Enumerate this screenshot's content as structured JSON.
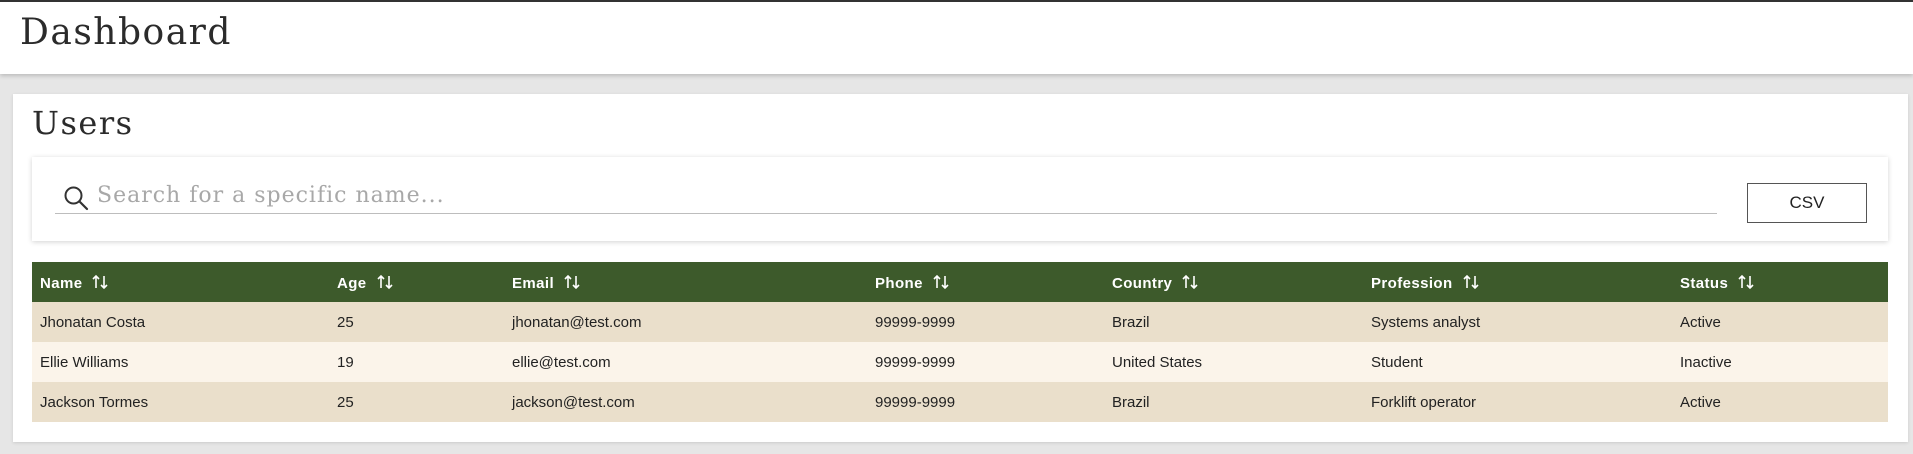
{
  "header": {
    "title": "Dashboard"
  },
  "users_section": {
    "title": "Users",
    "search": {
      "placeholder": "Search for a specific name...",
      "value": ""
    },
    "csv_button_label": "CSV"
  },
  "table": {
    "columns": [
      "Name",
      "Age",
      "Email",
      "Phone",
      "Country",
      "Profession",
      "Status"
    ],
    "rows": [
      [
        "Jhonatan Costa",
        "25",
        "jhonatan@test.com",
        "99999-9999",
        "Brazil",
        "Systems analyst",
        "Active"
      ],
      [
        "Ellie Williams",
        "19",
        "ellie@test.com",
        "99999-9999",
        "United States",
        "Student",
        "Inactive"
      ],
      [
        "Jackson Tormes",
        "25",
        "jackson@test.com",
        "99999-9999",
        "Brazil",
        "Forklift operator",
        "Active"
      ]
    ]
  },
  "colors": {
    "header_green": "#3d5a2b",
    "row_odd": "#eadfcb",
    "row_even": "#fbf4ea"
  },
  "icons": {
    "search": "search-icon",
    "sort": "sort-icon"
  }
}
